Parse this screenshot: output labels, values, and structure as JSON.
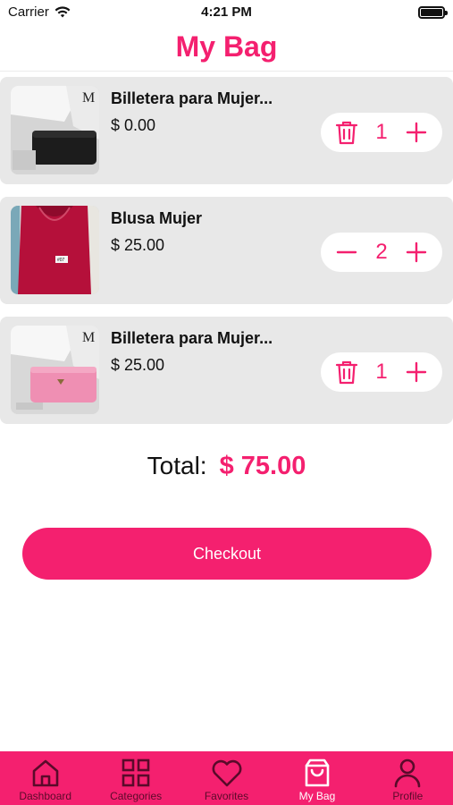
{
  "status_bar": {
    "carrier": "Carrier",
    "time": "4:21 PM"
  },
  "header": {
    "title": "My Bag"
  },
  "cart": {
    "items": [
      {
        "name": "Billetera para Mujer...",
        "price": "$ 0.00",
        "quantity": "1",
        "left_control": "trash-icon",
        "image": "black-wallet"
      },
      {
        "name": "Blusa Mujer",
        "price": "$ 25.00",
        "quantity": "2",
        "left_control": "minus-icon",
        "image": "red-blouse"
      },
      {
        "name": "Billetera para Mujer...",
        "price": "$ 25.00",
        "quantity": "1",
        "left_control": "trash-icon",
        "image": "pink-wallet"
      }
    ]
  },
  "summary": {
    "total_label": "Total:",
    "total_value": "$ 75.00"
  },
  "checkout": {
    "label": "Checkout"
  },
  "tabs": [
    {
      "label": "Dashboard",
      "icon": "home-icon"
    },
    {
      "label": "Categories",
      "icon": "grid-icon"
    },
    {
      "label": "Favorites",
      "icon": "heart-icon"
    },
    {
      "label": "My Bag",
      "icon": "bag-icon",
      "active": true
    },
    {
      "label": "Profile",
      "icon": "user-icon"
    }
  ],
  "colors": {
    "accent": "#f4206f",
    "card": "#e8e8e8",
    "tab_inactive_text": "#5a0a2a"
  }
}
